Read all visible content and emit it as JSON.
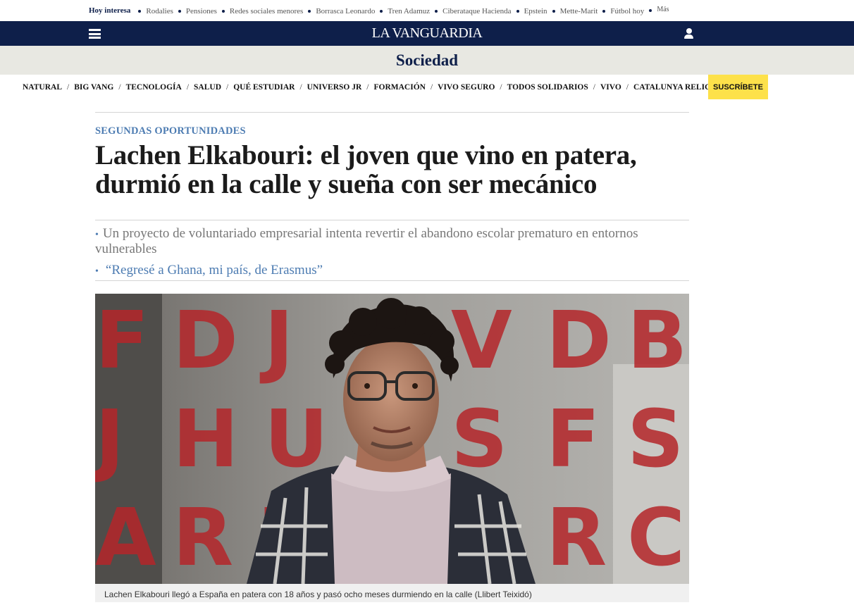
{
  "trending": {
    "lead": "Hoy interesa",
    "items": [
      "Rodalies",
      "Pensiones",
      "Redes sociales menores",
      "Borrasca Leonardo",
      "Tren Adamuz",
      "Ciberataque Hacienda",
      "Epstein",
      "Mette-Marit",
      "Fútbol hoy"
    ],
    "more": "Más"
  },
  "header": {
    "logo": "LA VANGUARDIA",
    "menu_icon": "hamburger-menu-icon",
    "user_icon": "user-icon",
    "brand_color": "#0e1f4a"
  },
  "section": {
    "title": "Sociedad"
  },
  "subnav": {
    "items": [
      "NATURAL",
      "BIG VANG",
      "TECNOLOGÍA",
      "SALUD",
      "QUÉ ESTUDIAR",
      "UNIVERSO JR",
      "FORMACIÓN",
      "VIVO SEGURO",
      "TODOS SOLIDARIOS",
      "VIVO",
      "CATALUNYA RELIGIÓ"
    ],
    "separator": "/",
    "subscribe_label": "SUSCRÍBETE",
    "subscribe_color": "#fde14a"
  },
  "article": {
    "kicker": "SEGUNDAS OPORTUNIDADES",
    "headline": "Lachen Elkabouri: el joven que vino en patera, durmió en la calle y sueña con ser mecánico",
    "summary": "Un proyecto de voluntariado empresarial intenta revertir el abandono escolar prematuro en entornos vulnerables",
    "related_link": "“Regresé a Ghana, mi país, de Erasmus”",
    "bullet": "•",
    "accent_color": "#4d7cb2",
    "photo_caption": "Lachen Elkabouri llegó a España en patera con 18 años y pasó ocho meses durmiendo en la calle (Llibert Teixidó)",
    "photo_background_letters": [
      "F",
      "D",
      "J",
      "V",
      "D",
      "B",
      "J",
      "H",
      "U",
      "S",
      "F",
      "S",
      "A",
      "R",
      "T",
      "R",
      "C"
    ]
  }
}
